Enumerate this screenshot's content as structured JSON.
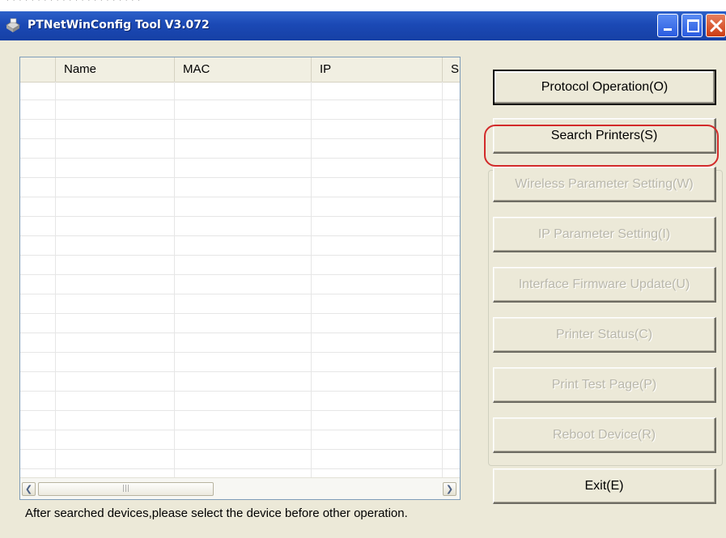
{
  "window": {
    "title": "PTNetWinConfig Tool V3.072"
  },
  "device_list": {
    "columns": [
      "Name",
      "MAC",
      "IP",
      "Su"
    ],
    "rows": []
  },
  "buttons": {
    "protocol_operation": "Protocol Operation(O)",
    "search_printers": "Search Printers(S)",
    "wireless_parameter_setting": "Wireless Parameter Setting(W)",
    "ip_parameter_setting": "IP Parameter Setting(I)",
    "interface_firmware_update": "Interface Firmware Update(U)",
    "printer_status": "Printer Status(C)",
    "print_test_page": "Print Test Page(P)",
    "reboot_device": "Reboot Device(R)",
    "exit": "Exit(E)"
  },
  "status_text": "After searched devices,please select the device before other operation.",
  "colors": {
    "titlebar": "#1b49b5",
    "window_bg": "#ece9d8",
    "highlight_ring": "#d22a2a",
    "disabled_text": "#b9b7ab"
  }
}
